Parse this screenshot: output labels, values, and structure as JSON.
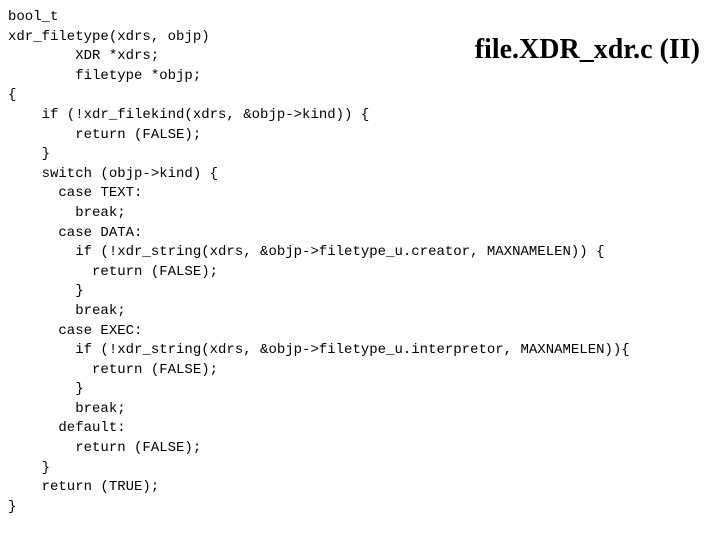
{
  "title": "file.XDR_xdr.c (II)",
  "code": "bool_t\nxdr_filetype(xdrs, objp)\n        XDR *xdrs;\n        filetype *objp;\n{\n    if (!xdr_filekind(xdrs, &objp->kind)) {\n        return (FALSE);\n    }\n    switch (objp->kind) {\n      case TEXT:\n        break;\n      case DATA:\n        if (!xdr_string(xdrs, &objp->filetype_u.creator, MAXNAMELEN)) {\n          return (FALSE);\n        }\n        break;\n      case EXEC:\n        if (!xdr_string(xdrs, &objp->filetype_u.interpretor, MAXNAMELEN)){\n          return (FALSE);\n        }\n        break;\n      default:\n        return (FALSE);\n    }\n    return (TRUE);\n}"
}
